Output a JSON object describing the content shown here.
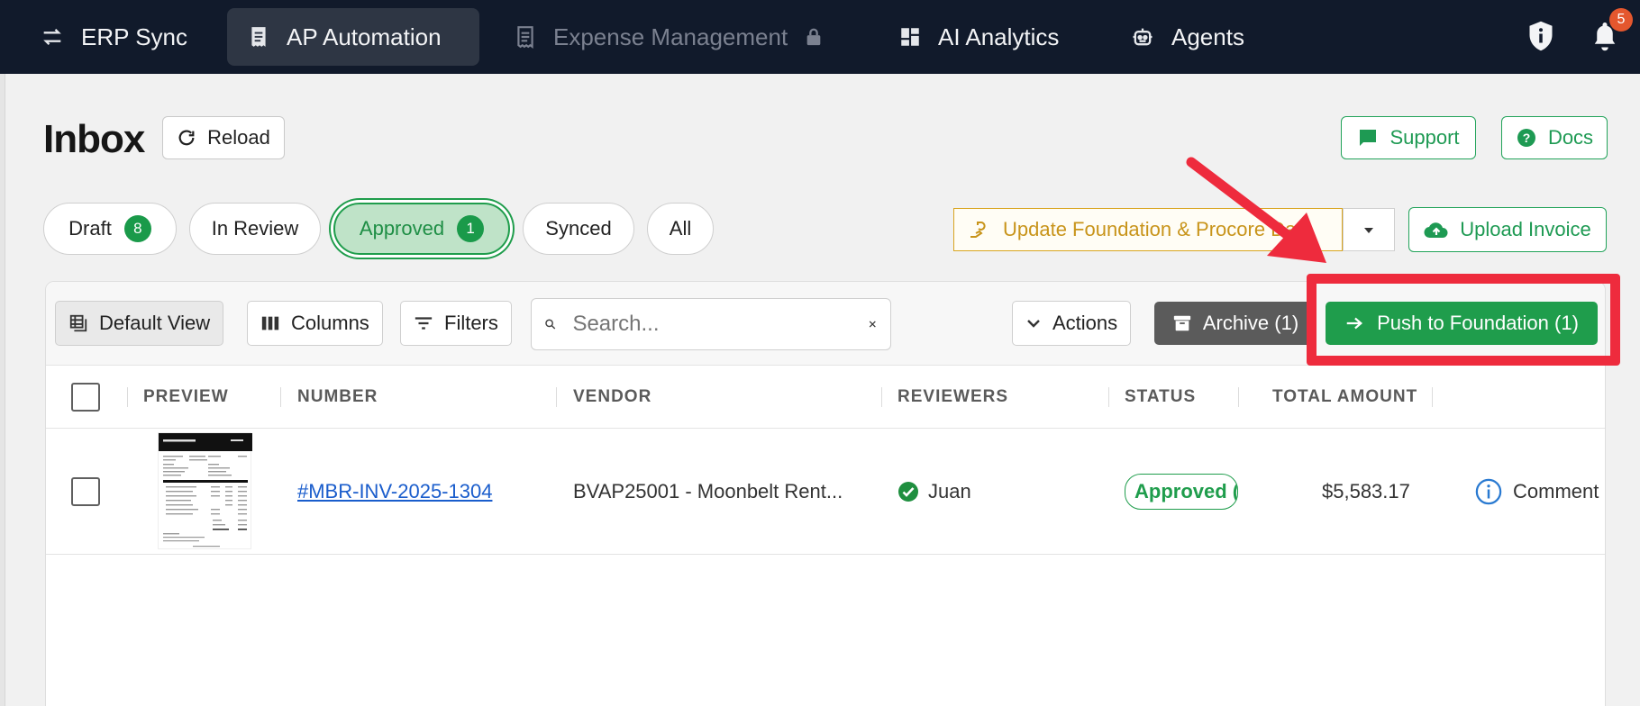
{
  "nav": {
    "items": [
      {
        "label": "ERP Sync",
        "icon": "arrows-icon"
      },
      {
        "label": "AP Automation",
        "icon": "receipt-icon"
      },
      {
        "label": "Expense Management",
        "icon": "receipt-icon"
      },
      {
        "label": "AI Analytics",
        "icon": "dashboard-icon"
      },
      {
        "label": "Agents",
        "icon": "robot-icon"
      }
    ],
    "active_index": 1,
    "notification_count": "5"
  },
  "header": {
    "title": "Inbox",
    "reload_label": "Reload",
    "support_label": "Support",
    "docs_label": "Docs"
  },
  "tabs": [
    {
      "label": "Draft",
      "count": "8"
    },
    {
      "label": "In Review"
    },
    {
      "label": "Approved",
      "count": "1"
    },
    {
      "label": "Synced"
    },
    {
      "label": "All"
    }
  ],
  "actions": {
    "update_label": "Update Foundation & Procore Data",
    "upload_label": "Upload Invoice"
  },
  "toolbar": {
    "default_view_label": "Default View",
    "columns_label": "Columns",
    "filters_label": "Filters",
    "search_placeholder": "Search...",
    "actions_label": "Actions",
    "archive_label": "Archive (1)",
    "push_label": "Push to Foundation (1)"
  },
  "table": {
    "columns": [
      "PREVIEW",
      "NUMBER",
      "VENDOR",
      "REVIEWERS",
      "STATUS",
      "TOTAL AMOUNT"
    ],
    "rows": [
      {
        "number": "#MBR-INV-2025-1304",
        "vendor": "BVAP25001 - Moonbelt Rent...",
        "reviewer": "Juan",
        "status": "Approved (",
        "total": "$5,583.17",
        "comment": "Comment"
      }
    ]
  },
  "colors": {
    "nav_bg": "#111a2b",
    "accent_green": "#1f9d4c",
    "annotation_red": "#ee2b3d",
    "warning_gold": "#c8941a"
  }
}
